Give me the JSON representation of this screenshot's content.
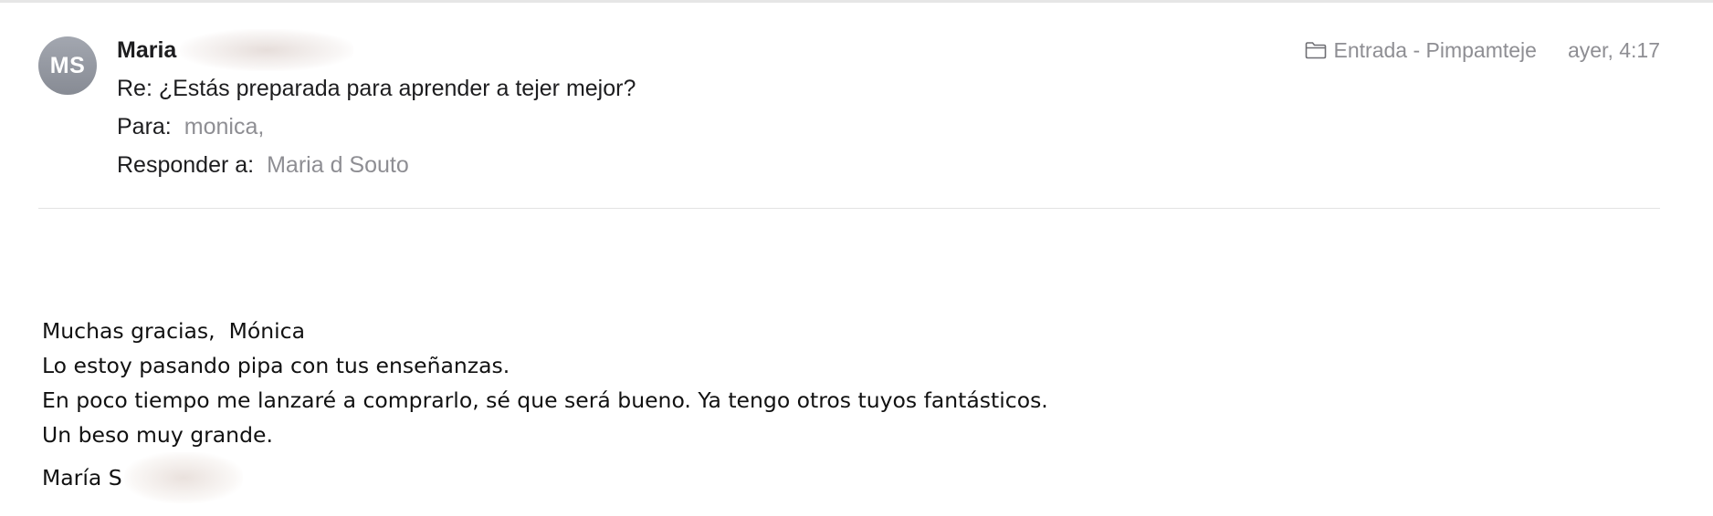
{
  "message": {
    "avatar_initials": "MS",
    "sender_name": "Maria",
    "folder_icon": "folder-icon",
    "folder": "Entrada - Pimpamteje",
    "time": "ayer, 4:17",
    "subject": "Re: ¿Estás preparada para aprender a tejer mejor?",
    "to_label": "Para:",
    "to_value": "monica,",
    "reply_label": "Responder a:",
    "reply_value": "Maria d Souto"
  },
  "body": {
    "lines": [
      "Muchas gracias,  Mónica",
      "Lo estoy pasando pipa con tus enseñanzas.",
      "En poco tiempo me lanzaré a comprarlo, sé que será bueno. Ya tengo otros tuyos fantásticos.",
      "Un beso muy grande."
    ],
    "signature": "María S"
  },
  "colors": {
    "avatar": "#979ba4",
    "secondary_text": "#8e8e93",
    "divider": "#e3e3e3"
  }
}
